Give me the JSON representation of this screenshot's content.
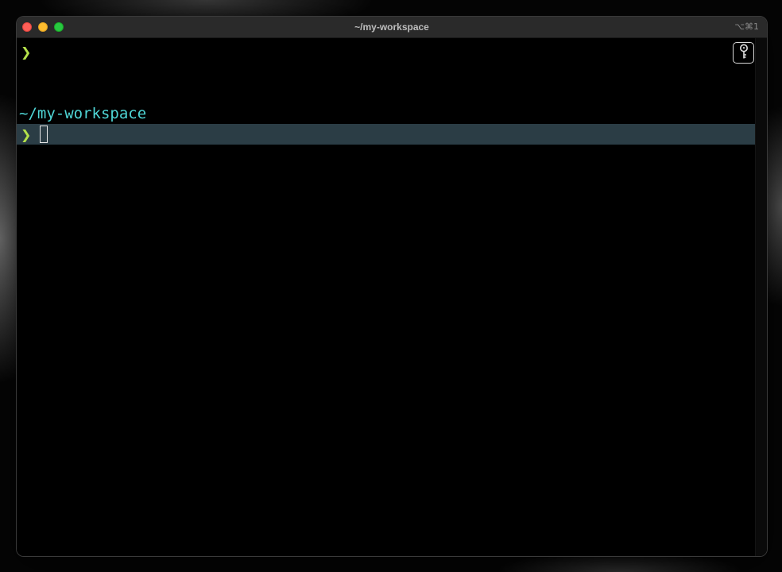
{
  "window": {
    "title": "~/my-workspace",
    "shortcut": "⌥⌘1"
  },
  "terminal": {
    "prompt_symbol": "❯",
    "lines": [
      {
        "type": "prompt",
        "symbol": "❯"
      },
      {
        "type": "cwd",
        "text": "~/my-workspace"
      },
      {
        "type": "active-prompt",
        "symbol": "❯",
        "input": ""
      }
    ],
    "cwd": "~/my-workspace"
  },
  "icons": {
    "traffic_lights": [
      "close-icon",
      "minimize-icon",
      "zoom-icon"
    ],
    "key_button": "key-icon"
  },
  "colors": {
    "prompt": "#b4e14a",
    "cwd": "#4fd6d6",
    "active_line": "#2b3d45",
    "background": "#000000",
    "titlebar": "#2a2a2a"
  }
}
